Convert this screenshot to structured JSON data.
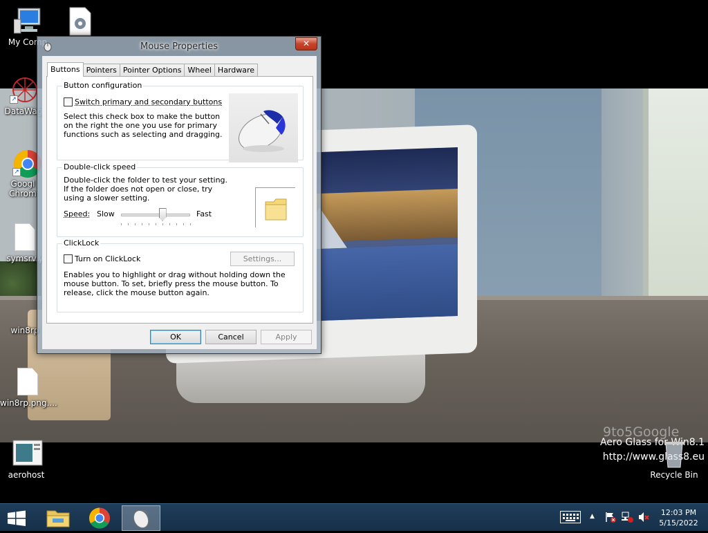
{
  "desktop": {
    "icons": [
      {
        "label": "My Comp"
      },
      {
        "label": "DataWag"
      },
      {
        "label": "Googl Chrom"
      },
      {
        "label": "symsrv.y"
      },
      {
        "label": "win8rp"
      },
      {
        "label": "win8rp.png...."
      },
      {
        "label": "aerohost"
      },
      {
        "label": "Recycle Bin"
      }
    ],
    "watermark": "9to5Google",
    "aero_line1": "Aero Glass for Win8.1",
    "aero_line2": "http://www.glass8.eu"
  },
  "dialog": {
    "title": "Mouse Properties",
    "close_label": "✕",
    "tabs": [
      {
        "label": "Buttons",
        "active": true
      },
      {
        "label": "Pointers",
        "active": false
      },
      {
        "label": "Pointer Options",
        "active": false
      },
      {
        "label": "Wheel",
        "active": false
      },
      {
        "label": "Hardware",
        "active": false
      }
    ],
    "button_config": {
      "group_label": "Button configuration",
      "checkbox_label": "Switch primary and secondary buttons",
      "checked": false,
      "description": "Select this check box to make the button on the right the one you use for primary functions such as selecting and dragging."
    },
    "double_click": {
      "group_label": "Double-click speed",
      "description": "Double-click the folder to test your setting. If the folder does not open or close, try using a slower setting.",
      "speed_label": "Speed:",
      "slow_label": "Slow",
      "fast_label": "Fast",
      "speed_value": 0.6
    },
    "clicklock": {
      "group_label": "ClickLock",
      "checkbox_label": "Turn on ClickLock",
      "checked": false,
      "settings_label": "Settings...",
      "description": "Enables you to highlight or drag without holding down the mouse button. To set, briefly press the mouse button. To release, click the mouse button again."
    },
    "buttons": {
      "ok": "OK",
      "cancel": "Cancel",
      "apply": "Apply"
    }
  },
  "taskbar": {
    "time": "12:03 PM",
    "date": "5/15/2022"
  }
}
